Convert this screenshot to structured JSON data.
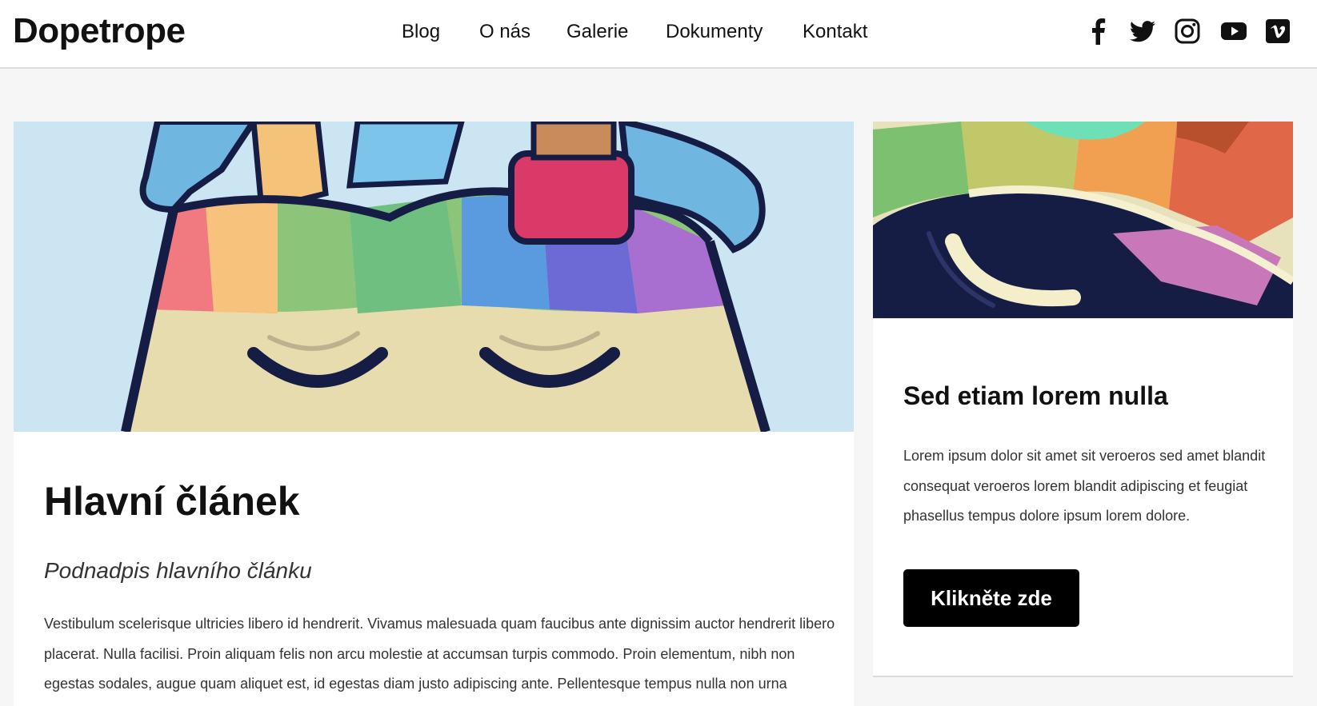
{
  "header": {
    "logo": "Dopetrope",
    "nav": [
      "Blog",
      "O nás",
      "Galerie",
      "Dokumenty",
      "Kontakt"
    ],
    "social_icons": [
      "facebook-icon",
      "twitter-icon",
      "instagram-icon",
      "youtube-icon",
      "vimeo-icon"
    ]
  },
  "main_article": {
    "title": "Hlavní článek",
    "subtitle": "Podnadpis hlavního článku",
    "body": "Vestibulum scelerisque ultricies libero id hendrerit. Vivamus malesuada quam faucibus ante dignissim auctor hendrerit libero placerat. Nulla facilisi. Proin aliquam felis non arcu molestie at accumsan turpis commodo. Proin elementum, nibh non egestas sodales, augue quam aliquet est, id egestas diam justo adipiscing ante. Pellentesque tempus nulla non urna"
  },
  "side_article": {
    "title": "Sed etiam lorem nulla",
    "body": "Lorem ipsum dolor sit amet sit veroeros sed amet blandit consequat veroeros lorem blandit adipiscing et feugiat phasellus tempus dolore ipsum lorem dolore.",
    "button": "Klikněte zde"
  },
  "colors": {
    "background": "#f6f6f6",
    "card": "#ffffff",
    "button": "#000000",
    "art_sky": "#cbe6f2",
    "art_face": "#e6dcae",
    "art_navy": "#151d45"
  }
}
